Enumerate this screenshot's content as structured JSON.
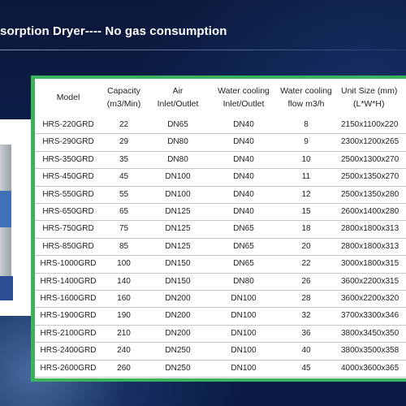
{
  "title": "sorption Dryer---- No gas consumption",
  "table": {
    "headers": {
      "model": [
        "Model"
      ],
      "capacity": [
        "Capacity",
        "(m3/Min)"
      ],
      "air": [
        "Air",
        "Inlet/Outlet"
      ],
      "water": [
        "Water cooling",
        "Inlet/Outlet"
      ],
      "flow": [
        "Water cooling",
        "flow m3/h"
      ],
      "size": [
        "Unit Size (mm)",
        "(L*W*H)"
      ]
    },
    "rows": [
      {
        "model": "HRS-220GRD",
        "capacity": "22",
        "air": "DN65",
        "water": "DN40",
        "flow": "8",
        "size": "2150x1100x220"
      },
      {
        "model": "HRS-290GRD",
        "capacity": "29",
        "air": "DN80",
        "water": "DN40",
        "flow": "9",
        "size": "2300x1200x265"
      },
      {
        "model": "HRS-350GRD",
        "capacity": "35",
        "air": "DN80",
        "water": "DN40",
        "flow": "10",
        "size": "2500x1300x270"
      },
      {
        "model": "HRS-450GRD",
        "capacity": "45",
        "air": "DN100",
        "water": "DN40",
        "flow": "11",
        "size": "2500x1350x270"
      },
      {
        "model": "HRS-550GRD",
        "capacity": "55",
        "air": "DN100",
        "water": "DN40",
        "flow": "12",
        "size": "2500x1350x280"
      },
      {
        "model": "HRS-650GRD",
        "capacity": "65",
        "air": "DN125",
        "water": "DN40",
        "flow": "15",
        "size": "2600x1400x280"
      },
      {
        "model": "HRS-750GRD",
        "capacity": "75",
        "air": "DN125",
        "water": "DN65",
        "flow": "18",
        "size": "2800x1800x313"
      },
      {
        "model": "HRS-850GRD",
        "capacity": "85",
        "air": "DN125",
        "water": "DN65",
        "flow": "20",
        "size": "2800x1800x313"
      },
      {
        "model": "HRS-1000GRD",
        "capacity": "100",
        "air": "DN150",
        "water": "DN65",
        "flow": "22",
        "size": "3000x1800x315"
      },
      {
        "model": "HRS-1400GRD",
        "capacity": "140",
        "air": "DN150",
        "water": "DN80",
        "flow": "26",
        "size": "3600x2200x315"
      },
      {
        "model": "HRS-1600GRD",
        "capacity": "160",
        "air": "DN200",
        "water": "DN100",
        "flow": "28",
        "size": "3600x2200x320"
      },
      {
        "model": "HRS-1900GRD",
        "capacity": "190",
        "air": "DN200",
        "water": "DN100",
        "flow": "32",
        "size": "3700x3300x346"
      },
      {
        "model": "HRS-2100GRD",
        "capacity": "210",
        "air": "DN200",
        "water": "DN100",
        "flow": "36",
        "size": "3800x3450x350"
      },
      {
        "model": "HRS-2400GRD",
        "capacity": "240",
        "air": "DN250",
        "water": "DN100",
        "flow": "40",
        "size": "3800x3500x358"
      },
      {
        "model": "HRS-2600GRD",
        "capacity": "260",
        "air": "DN250",
        "water": "DN100",
        "flow": "45",
        "size": "4000x3600x365"
      }
    ]
  },
  "colors": {
    "table_border": "#3bb25c",
    "background": "#0b1a3e",
    "title_text": "#ffffff"
  }
}
